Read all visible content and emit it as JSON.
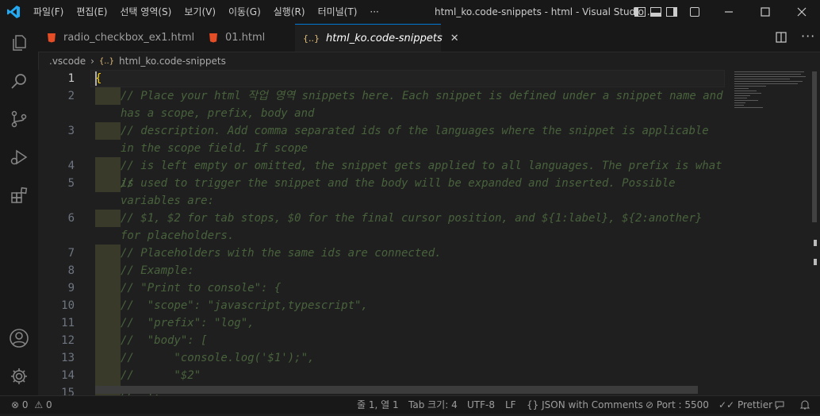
{
  "window": {
    "title": "html_ko.code-snippets - html - Visual Studio ...",
    "menu": [
      "파일(F)",
      "편집(E)",
      "선택 영역(S)",
      "보기(V)",
      "이동(G)",
      "실행(R)",
      "터미널(T)",
      "···"
    ]
  },
  "tabs": [
    {
      "label": "radio_checkbox_ex1.html",
      "icon": "html5-icon"
    },
    {
      "label": "01.html",
      "icon": "html5-icon"
    },
    {
      "label": "html_ko.code-snippets",
      "icon": "braces-icon",
      "active": true
    }
  ],
  "tab_close": "✕",
  "breadcrumb": {
    "folder": ".vscode",
    "separator": "›",
    "file_icon": "{..}",
    "file": "html_ko.code-snippets"
  },
  "editor": {
    "line_numbers": [
      "1",
      "2",
      "3",
      "4",
      "5",
      "6",
      "7",
      "8",
      "9",
      "10",
      "11",
      "12",
      "13",
      "14",
      "15"
    ],
    "lines": [
      "{",
      "// Place your html 작업 영역 snippets here. Each snippet is defined under a snippet name and has a scope, prefix, body and",
      "// description. Add comma separated ids of the languages where the snippet is applicable in the scope field. If scope",
      "// is left empty or omitted, the snippet gets applied to all languages. The prefix is what is",
      "// used to trigger the snippet and the body will be expanded and inserted. Possible variables are:",
      "// $1, $2 for tab stops, $0 for the final cursor position, and ${1:label}, ${2:another} for placeholders.",
      "// Placeholders with the same ids are connected.",
      "// Example:",
      "// \"Print to console\": {",
      "//  \"scope\": \"javascript,typescript\",",
      "//  \"prefix\": \"log\",",
      "//  \"body\": [",
      "//      \"console.log('$1');\",",
      "//      \"$2\"",
      "//  ],"
    ]
  },
  "status": {
    "errors": "0",
    "warnings": "0",
    "position": "줄 1, 열 1",
    "tab_size": "Tab 크기: 4",
    "encoding": "UTF-8",
    "eol": "LF",
    "language": "JSON with Comments",
    "port": "Port : 5500",
    "prettier": "Prettier"
  },
  "colors": {
    "accent": "#0078d4",
    "vscode_blue": "#23a9f2",
    "comment": "#6a9955"
  }
}
